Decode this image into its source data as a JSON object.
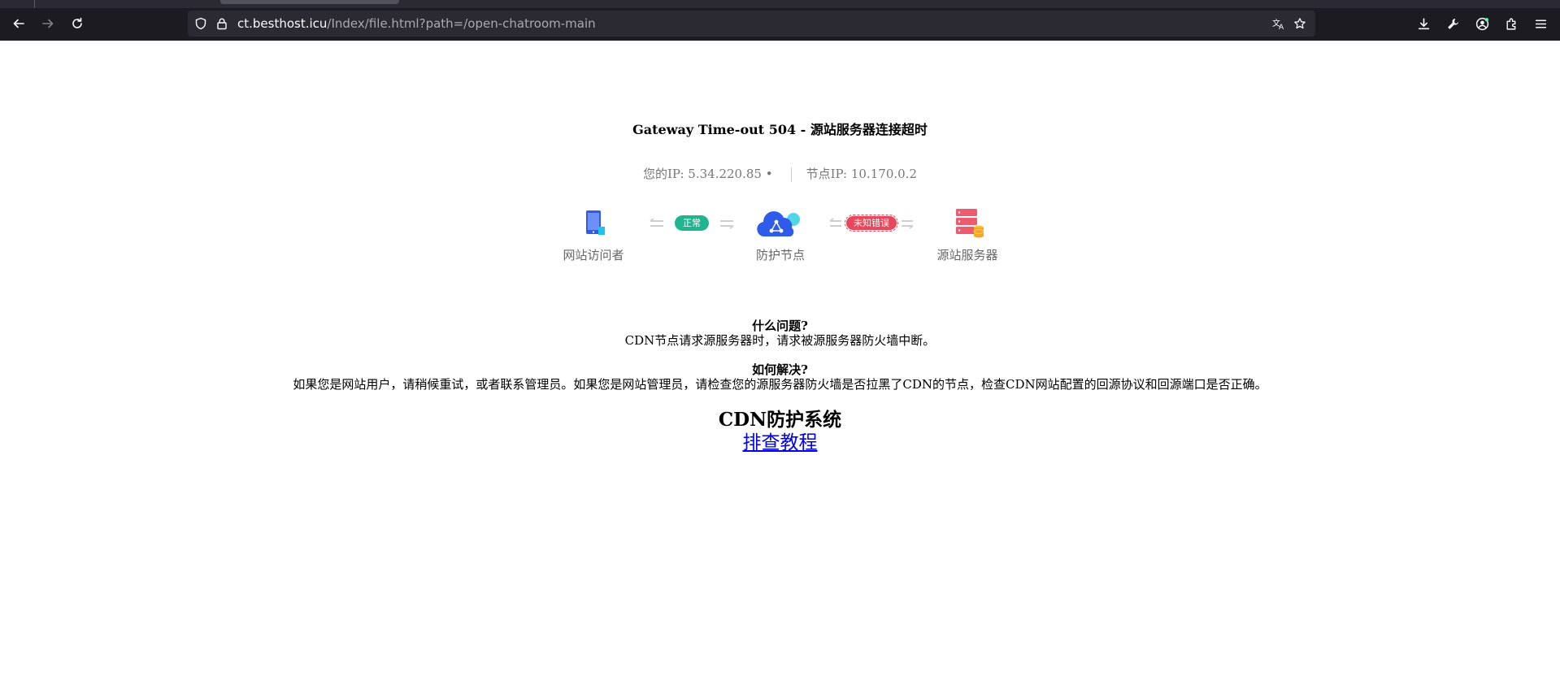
{
  "browser": {
    "url_host": "ct.besthost.icu",
    "url_path": "/Index/file.html?path=/open-chatroom-main"
  },
  "page": {
    "title": "Gateway Time-out 504 - 源站服务器连接超时",
    "your_ip_label": "您的IP: 5.34.220.85 •",
    "node_ip_label": "节点IP: 10.170.0.2",
    "nodes": [
      {
        "label": "网站访问者"
      },
      {
        "label": "防护节点"
      },
      {
        "label": "源站服务器"
      }
    ],
    "connectors": [
      {
        "status": "正常",
        "color": "#1fb58f"
      },
      {
        "status": "未知错误",
        "color": "#e8485c"
      }
    ],
    "problem": {
      "question": "什么问题?",
      "answer": "CDN节点请求源服务器时，请求被源服务器防火墙中断。"
    },
    "solution": {
      "question": "如何解决?",
      "answer": "如果您是网站用户，请稍候重试，或者联系管理员。如果您是网站管理员，请检查您的源服务器防火墙是否拉黑了CDN的节点，检查CDN网站配置的回源协议和回源端口是否正确。"
    },
    "system_title": "CDN防护系统",
    "guide_link": "排查教程"
  },
  "colors": {
    "ok": "#1fb58f",
    "error": "#e8485c",
    "link": "#0000ee"
  }
}
